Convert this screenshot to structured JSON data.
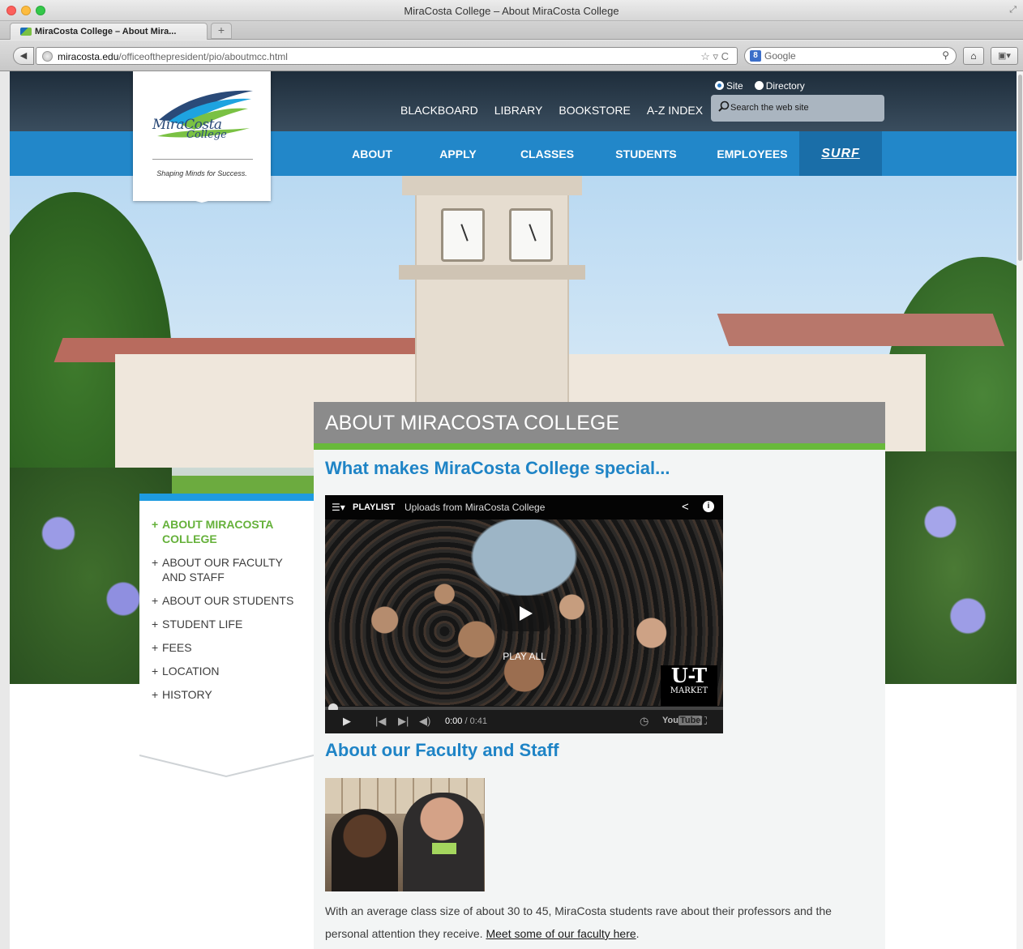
{
  "browser": {
    "window_title": "MiraCosta College – About MiraCosta College",
    "tab_title": "MiraCosta College – About Mira...",
    "new_tab_label": "+",
    "url_domain": "miracosta.edu",
    "url_path": "/officeofthepresident/pio/aboutmcc.html",
    "search_engine": "Google",
    "google_badge": "8",
    "back_glyph": "◀",
    "home_glyph": "⌂",
    "ext_glyph": "▣▾",
    "star_glyph": "☆ ▿ C",
    "mag_glyph": "⚲",
    "fullscreen_glyph": "⤢"
  },
  "logo": {
    "line1": "MiraCosta",
    "line2": "College",
    "tagline": "Shaping Minds for Success.",
    "colors": {
      "blue": "#2a4a78",
      "green": "#7ac143",
      "cyan": "#1ea3e0"
    }
  },
  "utility_nav": [
    "BLACKBOARD",
    "LIBRARY",
    "BOOKSTORE",
    "A-Z INDEX"
  ],
  "site_search": {
    "scope_options": [
      "Site",
      "Directory"
    ],
    "selected_scope": "Site",
    "placeholder": "Search the web site",
    "icon": "magnifier-icon"
  },
  "main_nav": [
    "ABOUT",
    "APPLY",
    "CLASSES",
    "STUDENTS",
    "EMPLOYEES",
    "SURF"
  ],
  "side_menu": {
    "items": [
      {
        "label": "ABOUT MIRACOSTA COLLEGE",
        "active": true
      },
      {
        "label": "ABOUT OUR FACULTY AND STAFF",
        "active": false
      },
      {
        "label": "ABOUT OUR STUDENTS",
        "active": false
      },
      {
        "label": "STUDENT LIFE",
        "active": false
      },
      {
        "label": "FEES",
        "active": false
      },
      {
        "label": "LOCATION",
        "active": false
      },
      {
        "label": "HISTORY",
        "active": false
      }
    ],
    "bullet": "+"
  },
  "content": {
    "header": "ABOUT MIRACOSTA COLLEGE",
    "heading_special": "What makes MiraCosta College special...",
    "heading_faculty": "About our Faculty and Staff",
    "body_before_link": "With an average class size of about 30 to 45, MiraCosta students rave about their professors and the personal attention they receive. ",
    "body_link": "Meet some of our faculty here",
    "body_after_link": "."
  },
  "video": {
    "playlist_label": "PLAYLIST",
    "playlist_title": "Uploads from MiraCosta College",
    "play_all": "PLAY ALL",
    "badge_logo": "U-T",
    "badge_sub": "MARKET",
    "time_current": "0:00",
    "time_total": " / 0:41",
    "youtube_you": "You",
    "youtube_tube": "Tube",
    "progress_fraction": 0.0
  },
  "colors": {
    "nav_blue": "#2287c9",
    "surf_blue": "#1a6ea8",
    "heading_blue": "#1f84c6",
    "accent_green": "#68b93a",
    "header_gray": "#8b8b8b"
  }
}
